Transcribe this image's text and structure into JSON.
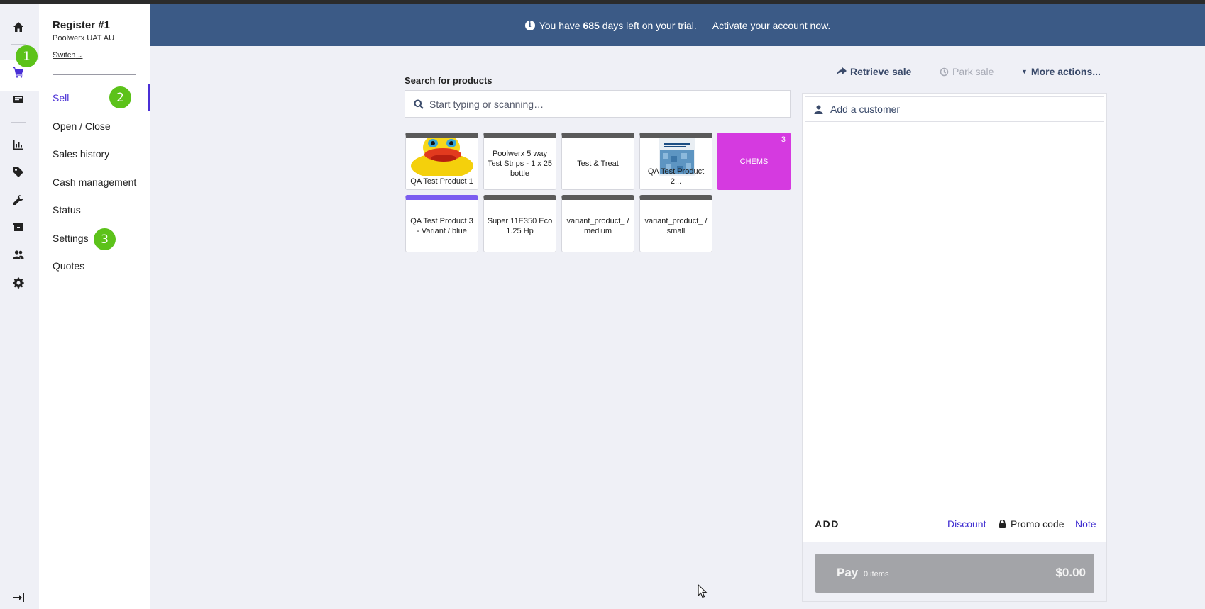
{
  "rail": {
    "icons": [
      "home-icon",
      "cart-icon",
      "register-icon",
      "reports-icon",
      "tag-icon",
      "wrench-icon",
      "inventory-icon",
      "customers-icon",
      "gear-icon"
    ],
    "active": "cart-icon",
    "active_color": "#4a2fd6"
  },
  "register": {
    "title": "Register #1",
    "store": "Poolwerx UAT AU",
    "switch_label": "Switch"
  },
  "nav": {
    "items": [
      {
        "label": "Sell",
        "active": true
      },
      {
        "label": "Open / Close"
      },
      {
        "label": "Sales history"
      },
      {
        "label": "Cash management"
      },
      {
        "label": "Status"
      },
      {
        "label": "Settings"
      },
      {
        "label": "Quotes"
      }
    ]
  },
  "badges": [
    "1",
    "2",
    "3"
  ],
  "banner": {
    "prefix": "You have",
    "days": "685",
    "suffix": "days left on your trial.",
    "link": "Activate your account now.",
    "color": "#3b5a86"
  },
  "search": {
    "label": "Search for products",
    "placeholder": "Start typing or scanning…"
  },
  "tiles": [
    {
      "label": "QA Test Product 1",
      "image": "rubber-duck"
    },
    {
      "label": "Poolwerx 5 way Test Strips - 1 x 25 bottle"
    },
    {
      "label": "Test & Treat"
    },
    {
      "label": "QA Test Product 2...",
      "image": "pool-salt-bag"
    },
    {
      "label": "CHEMS",
      "count": "3",
      "color": "#d53ae0"
    },
    {
      "label": "QA Test Product 3 - Variant / blue"
    },
    {
      "label": "Super 11E350 Eco 1.25 Hp"
    },
    {
      "label": "variant_product_ / medium"
    },
    {
      "label": "variant_product_ / small"
    }
  ],
  "actions": {
    "retrieve": "Retrieve sale",
    "park": "Park sale",
    "more": "More actions..."
  },
  "sale": {
    "customer_placeholder": "Add a customer",
    "add_label": "ADD",
    "discount": "Discount",
    "promo": "Promo code",
    "note": "Note",
    "pay_label": "Pay",
    "pay_items": "0 items",
    "pay_total": "$0.00"
  }
}
